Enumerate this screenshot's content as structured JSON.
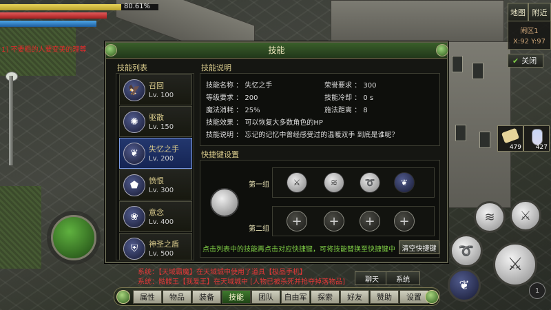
{
  "status": {
    "exp_percent_text": "80.61%",
    "exp_fraction": 0.8061
  },
  "notices": {
    "left_red": "1] 不要粗的人要变美的理尊"
  },
  "top_right": {
    "map_label": "地图",
    "nearby_label": "附近",
    "zone_name": "闹区1",
    "coords": "X:92 Y:97",
    "close_label": "关闭"
  },
  "inventory": {
    "item1_count": "479",
    "item2_count": "427"
  },
  "skill_window": {
    "title": "技能",
    "list_label": "技能列表",
    "desc_label": "技能说明",
    "skills": [
      {
        "name": "召回",
        "level": "Lv. 100",
        "icon": "eagle-icon"
      },
      {
        "name": "驱散",
        "level": "Lv. 150",
        "icon": "burst-icon"
      },
      {
        "name": "失忆之手",
        "level": "Lv. 200",
        "icon": "wing-hand-icon"
      },
      {
        "name": "愤恨",
        "level": "Lv. 300",
        "icon": "mask-icon"
      },
      {
        "name": "意念",
        "level": "Lv. 400",
        "icon": "flower-icon"
      },
      {
        "name": "神圣之盾",
        "level": "Lv. 500",
        "icon": "shield-icon"
      }
    ],
    "desc": {
      "skill_name_label": "技能名称 ： 失忆之手",
      "level_req_label": "等级要求 ： 200",
      "mana_label": "魔法消耗 ： 25%",
      "effect_label": "技能效果 ： 可以恢复大多数角色的HP",
      "explain_label": "技能说明 ： 忘记的记忆中曾经感受过的温暖双手 到底是谁呢？",
      "honor_label": "荣誉要求 ： 300",
      "cooldown_label": "技能冷却 ： 0 s",
      "range_label": "施法距离 ： 8"
    },
    "hotkey_label": "快捷键设置",
    "group1_label": "第一组",
    "group2_label": "第二组",
    "hint": "点击列表中的技能再点击对应快捷键，可将技能替换至快捷键中",
    "clear_label": "清空快捷键"
  },
  "chat": {
    "line1": "系统：【天域霸魔】在天域城中使用了道具【极品手机】",
    "line2": "系统：骷髅王【我爱王】在天域城中 [人物已被杀死并抢夺掉落物品]",
    "chat_label": "聊天",
    "system_label": "系统"
  },
  "tabs": [
    "属性",
    "物品",
    "装备",
    "技能",
    "团队",
    "自由军",
    "探索",
    "好友",
    "赞助",
    "设置"
  ],
  "active_tab": "技能",
  "corner_badge": "1"
}
